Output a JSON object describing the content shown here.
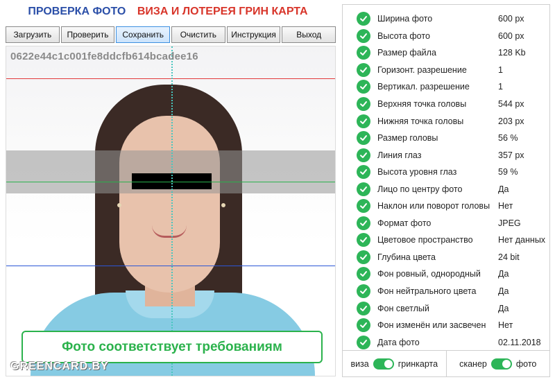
{
  "header": {
    "title_left": "ПРОВЕРКА ФОТО",
    "title_right": "ВИЗА И ЛОТЕРЕЯ ГРИН КАРТА"
  },
  "toolbar": {
    "buttons": [
      {
        "label": "Загрузить"
      },
      {
        "label": "Проверить"
      },
      {
        "label": "Сохранить",
        "active": true
      },
      {
        "label": "Очистить"
      },
      {
        "label": "Инструкция"
      },
      {
        "label": "Выход"
      }
    ]
  },
  "photo": {
    "hash": "0622e44c1c001fe8ddcfb614bcadee16",
    "result_message": "Фото соответствует требованиям",
    "watermark": "GREENCARD.BY"
  },
  "params": [
    {
      "label": "Ширина фото",
      "value": "600 px"
    },
    {
      "label": "Высота фото",
      "value": "600 px"
    },
    {
      "label": "Размер файла",
      "value": "128 Kb"
    },
    {
      "label": "Горизонт. разрешение",
      "value": "1"
    },
    {
      "label": "Вертикал. разрешение",
      "value": "1"
    },
    {
      "label": "Верхняя точка головы",
      "value": "544 px"
    },
    {
      "label": "Нижняя точка головы",
      "value": "203 px"
    },
    {
      "label": "Размер головы",
      "value": "56 %"
    },
    {
      "label": "Линия глаз",
      "value": "357 px"
    },
    {
      "label": "Высота уровня глаз",
      "value": "59 %"
    },
    {
      "label": "Лицо по центру фото",
      "value": "Да"
    },
    {
      "label": "Наклон или поворот головы",
      "value": "Нет"
    },
    {
      "label": "Формат фото",
      "value": "JPEG"
    },
    {
      "label": "Цветовое пространство",
      "value": "Нет данных"
    },
    {
      "label": "Глубина цвета",
      "value": "24 bit"
    },
    {
      "label": "Фон ровный, однородный",
      "value": "Да"
    },
    {
      "label": "Фон нейтрального цвета",
      "value": "Да"
    },
    {
      "label": "Фон светлый",
      "value": "Да"
    },
    {
      "label": "Фон изменён или засвечен",
      "value": "Нет"
    },
    {
      "label": "Дата фото",
      "value": "02.11.2018"
    }
  ],
  "footer": {
    "toggle1_left": "виза",
    "toggle1_right": "гринкарта",
    "toggle2_left": "сканер",
    "toggle2_right": "фото"
  },
  "icons": {
    "param_status": "check-circle-icon",
    "toggle": "toggle-switch-icon"
  },
  "colors": {
    "title_blue": "#2b4fa8",
    "title_red": "#d8352a",
    "ok_green": "#2db558",
    "top_line": "#e23a3a",
    "eye_line": "#2bb24c",
    "chin_line": "#2b56d6"
  }
}
